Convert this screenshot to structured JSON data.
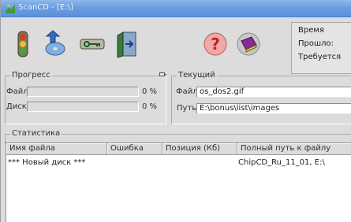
{
  "window": {
    "title": "ScanCD - [E:\\]"
  },
  "toolbar": {
    "buttons": [
      {
        "name": "traffic-light-icon"
      },
      {
        "name": "disc-arrow-icon"
      },
      {
        "name": "key-link-icon"
      },
      {
        "name": "door-exit-icon"
      },
      {
        "name": "help-question-icon"
      },
      {
        "name": "book-icon"
      }
    ]
  },
  "time": {
    "heading": "Время",
    "elapsed_label": "Прошло:",
    "required_label": "Требуется"
  },
  "progress": {
    "label": "Прогресс",
    "file_label": "Файл:",
    "file_percent": "0 %",
    "file_value": 0,
    "disk_label": "Диск:",
    "disk_percent": "0 %",
    "disk_value": 0
  },
  "current": {
    "label": "Текущий",
    "file_label": "Файл:",
    "file_value": "os_dos2.gif",
    "path_label": "Путь:",
    "path_value": "E:\\bonus\\list\\images"
  },
  "stats": {
    "label": "Статистика",
    "columns": [
      "Имя файла",
      "Ошибка",
      "Позиция (Кб)",
      "Полный путь к файлу"
    ],
    "rows": [
      [
        "*** Новый диск ***",
        "",
        "",
        "ChipCD_Ru_11_01, E:\\"
      ]
    ]
  },
  "colors": {
    "titlebar": "#6a9ee2",
    "window_bg": "#dcdcdc"
  }
}
